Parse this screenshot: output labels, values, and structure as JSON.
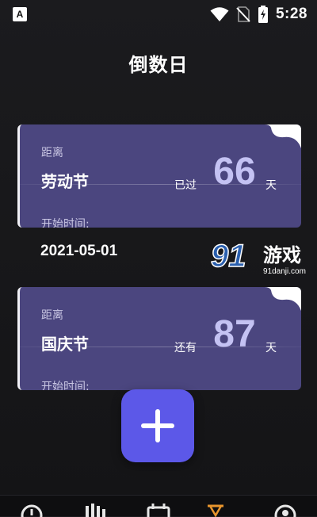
{
  "status_bar": {
    "app_icon_letter": "A",
    "time": "5:28"
  },
  "page": {
    "title": "倒数日"
  },
  "cards": [
    {
      "distance_label": "距离",
      "event_name": "劳动节",
      "status": "已过",
      "days": "66",
      "unit": "天",
      "start_label": "开始时间:",
      "start_date": "2021-05-01"
    },
    {
      "distance_label": "距离",
      "event_name": "国庆节",
      "status": "还有",
      "days": "87",
      "unit": "天",
      "start_label": "开始时间:"
    }
  ],
  "watermark": {
    "logo_number": "91",
    "logo_text": "游戏",
    "site": "91danji.com"
  },
  "bottom_nav": {
    "icons": [
      "clock-icon",
      "chart-icon",
      "calendar-icon",
      "hourglass-icon",
      "profile-icon"
    ],
    "active_index": 3,
    "active_color": "#e8952d"
  },
  "colors": {
    "card_bg": "#4b467f",
    "days_number": "#c4c2f3",
    "add_button": "#5c58e8"
  }
}
